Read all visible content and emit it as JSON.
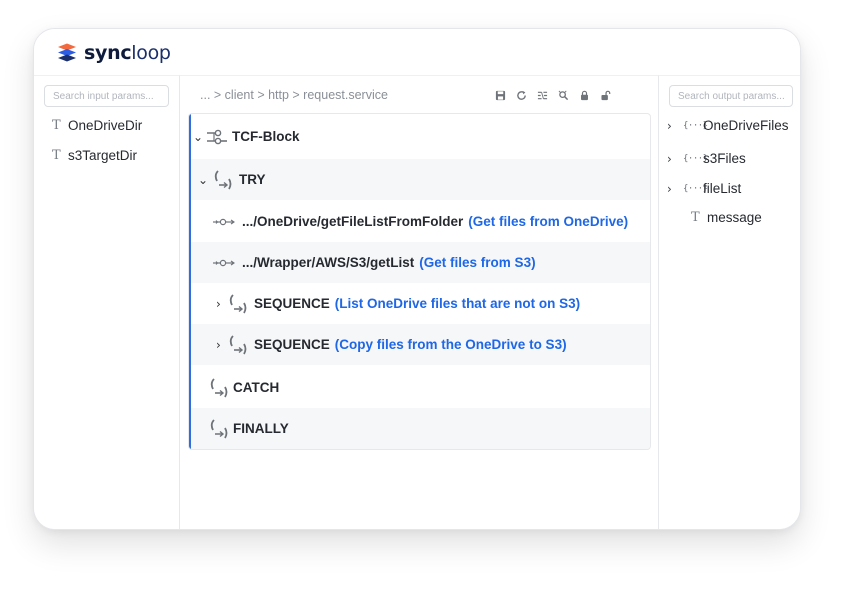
{
  "app": {
    "brand_sync": "sync",
    "brand_loop": "loop"
  },
  "left_panel": {
    "search_placeholder": "Search input params...",
    "params": [
      {
        "icon": "text-type-icon",
        "label": "OneDriveDir"
      },
      {
        "icon": "text-type-icon",
        "label": "s3TargetDir"
      }
    ]
  },
  "center": {
    "breadcrumb": "... > client > http > request.service",
    "toolbar": [
      "save-icon",
      "refresh-icon",
      "map-icon",
      "debug-icon",
      "lock-icon",
      "unlock-icon"
    ],
    "flow": {
      "tcf_block": "TCF-Block",
      "try": "TRY",
      "invoke1_path": ".../OneDrive/getFileListFromFolder",
      "invoke1_desc": "(Get files from OneDrive)",
      "invoke2_path": ".../Wrapper/AWS/S3/getList",
      "invoke2_desc": "(Get files from S3)",
      "seq1_label": "SEQUENCE",
      "seq1_desc": "(List OneDrive files that are not on S3)",
      "seq2_label": "SEQUENCE",
      "seq2_desc": "(Copy files from the OneDrive to S3)",
      "catch": "CATCH",
      "finally": "FINALLY"
    }
  },
  "right_panel": {
    "search_placeholder": "Search output params...",
    "items": [
      {
        "label": "OneDriveFiles",
        "icon": "document-brace-icon",
        "expandable": true
      },
      {
        "label": "s3Files",
        "icon": "document-brace-icon",
        "expandable": true
      },
      {
        "label": "fileList",
        "icon": "document-brace-icon",
        "expandable": true
      },
      {
        "label": "message",
        "icon": "text-type-icon",
        "expandable": false
      }
    ]
  },
  "colors": {
    "accent": "#1e67e6",
    "flow_border": "#2f6de1",
    "brand_dark": "#0e1b3d",
    "logo_orange": "#f26a3d",
    "logo_blue": "#2c5de5"
  }
}
